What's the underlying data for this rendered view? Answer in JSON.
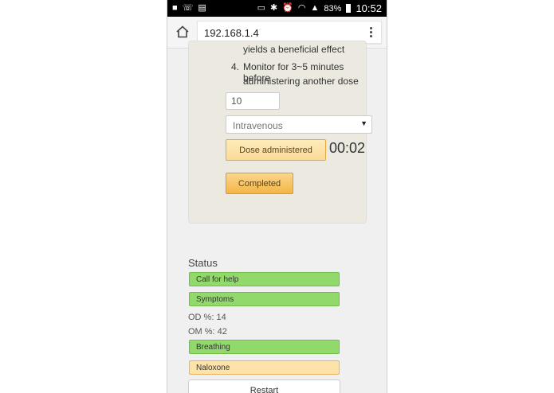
{
  "status_bar": {
    "battery": "83%",
    "time": "10:52"
  },
  "browser": {
    "url": "192.168.1.4"
  },
  "instructions": {
    "step3_fragment": "yields a beneficial effect",
    "step4_number": "4.",
    "step4_line1": "Monitor for 3~5 minutes before",
    "step4_line2": "administering another dose"
  },
  "dose_form": {
    "dose_value": "10",
    "route_selected": "Intravenous",
    "dose_button_label": "Dose administered",
    "timer": "00:02",
    "completed_button_label": "Completed"
  },
  "status": {
    "title": "Status",
    "call_for_help": "Call for help",
    "symptoms": "Symptoms",
    "od_percent": "OD %: 14",
    "om_percent": "OM %: 42",
    "breathing": "Breathing",
    "naloxone": "Naloxone",
    "restart_label": "Restart"
  },
  "colors": {
    "status_green": "#92d96c",
    "status_amber": "#fde3aa",
    "button_orange": "#f4b547"
  }
}
